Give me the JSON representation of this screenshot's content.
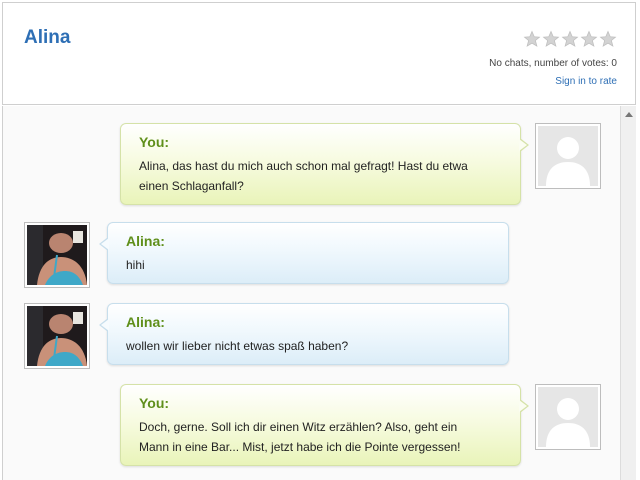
{
  "profile": {
    "name": "Alina",
    "rating": 0,
    "rating_max": 5,
    "vote_text": "No chats, number of votes: 0",
    "signin_text": "Sign in to rate"
  },
  "colors": {
    "accent": "#2e6fb5",
    "speaker_name": "#5f8f1a",
    "star_empty": "#cfcfcf"
  },
  "messages": [
    {
      "sender": "You:",
      "side": "you",
      "lines": [
        "Alina, das hast du mich auch schon mal gefragt! Hast du etwa",
        "einen Schlaganfall?"
      ]
    },
    {
      "sender": "Alina:",
      "side": "alina",
      "lines": [
        "hihi"
      ]
    },
    {
      "sender": "Alina:",
      "side": "alina",
      "lines": [
        "wollen wir lieber nicht etwas spaß haben?"
      ]
    },
    {
      "sender": "You:",
      "side": "you",
      "lines": [
        "Doch, gerne. Soll ich dir einen Witz erzählen? Also, geht ein",
        "Mann in eine Bar... Mist, jetzt habe ich die Pointe vergessen!"
      ]
    }
  ]
}
